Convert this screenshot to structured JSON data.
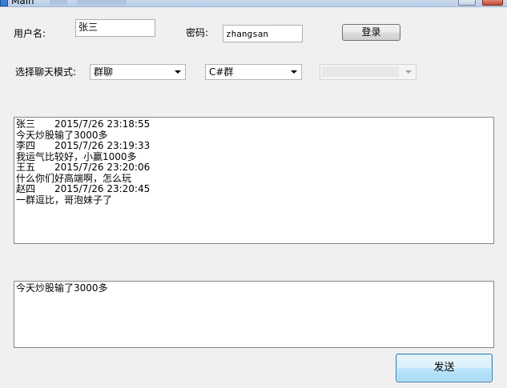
{
  "window": {
    "title": "Main"
  },
  "login": {
    "username_label": "用户名:",
    "username_value": "张三",
    "password_label": "密码:",
    "password_value": "zhangsan",
    "login_button": "登录"
  },
  "chat_mode": {
    "label": "选择聊天模式:",
    "mode_selected": "群聊",
    "group_selected": "C#群",
    "member_selected": ""
  },
  "messages": [
    {
      "sender": "张三",
      "time": "2015/7/26 23:18:55",
      "text": "今天炒股输了3000多"
    },
    {
      "sender": "李四",
      "time": "2015/7/26 23:19:33",
      "text": "我运气比较好，小赢1000多"
    },
    {
      "sender": "王五",
      "time": "2015/7/26 23:20:06",
      "text": "什么你们好高端啊，怎么玩"
    },
    {
      "sender": "赵四",
      "time": "2015/7/26 23:20:45",
      "text": "一群逗比，哥泡妹子了"
    }
  ],
  "compose": {
    "text": "今天炒股输了3000多",
    "send_button": "发送"
  }
}
